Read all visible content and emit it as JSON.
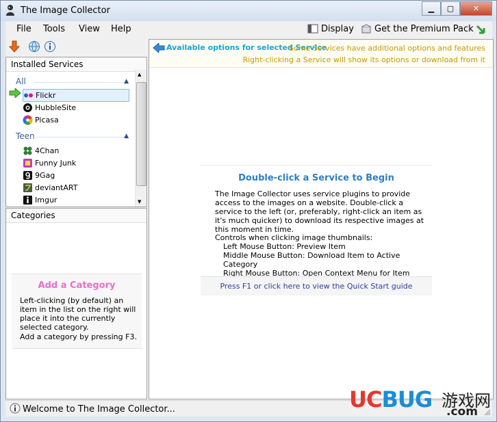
{
  "window": {
    "title": "The Image Collector"
  },
  "menu": [
    "File",
    "Tools",
    "View",
    "Help"
  ],
  "toolbar": {
    "display_label": "Display",
    "premium_label": "Get the Premium Pack"
  },
  "services_pane": {
    "header": "Installed Services",
    "groups": [
      {
        "name": "All",
        "items": [
          "Flickr",
          "HubbleSite",
          "Picasa"
        ],
        "selected": "Flickr"
      },
      {
        "name": "Teen",
        "items": [
          "4Chan",
          "Funny Junk",
          "9Gag",
          "deviantART",
          "Imgur"
        ]
      }
    ]
  },
  "categories_pane": {
    "header": "Categories",
    "add_title": "Add a Category",
    "add_text": "Left-clicking (by default) an item in the list on the right will place it into the currently selected category.",
    "add_hint": "Add a category by pressing F3."
  },
  "info_bar": {
    "title": "Available options for selected Service",
    "line1": "Some Services have additional options and features",
    "line2": "Right-clicking a Service will show its options or download from it"
  },
  "main": {
    "title": "Double-click a Service to Begin",
    "text": "The Image Collector uses service plugins to provide access to the images on a website. Double-click a service to the left (or, preferably, right-click an item as it's much quicker) to download its respective images at this moment in time.",
    "controls_header": "Controls when clicking image thumbnails:",
    "controls": [
      "Left Mouse Button: Preview Item",
      "Middle Mouse Button: Download Item to Active Category",
      "Right Mouse Button: Open Context Menu for Item"
    ],
    "quickstart": "Press F1 or click here to view the Quick Start guide"
  },
  "status": {
    "text": "Welcome to The Image Collector..."
  },
  "watermark": {
    "brand_u": "U",
    "brand_c": "C",
    "brand_bug": "BUG",
    "brand_cn": "游戏网",
    "brand_com": ".com"
  },
  "colors": {
    "accent_blue": "#2e7fc3",
    "info_gold": "#c79a00",
    "category_pink": "#e86fc9"
  }
}
